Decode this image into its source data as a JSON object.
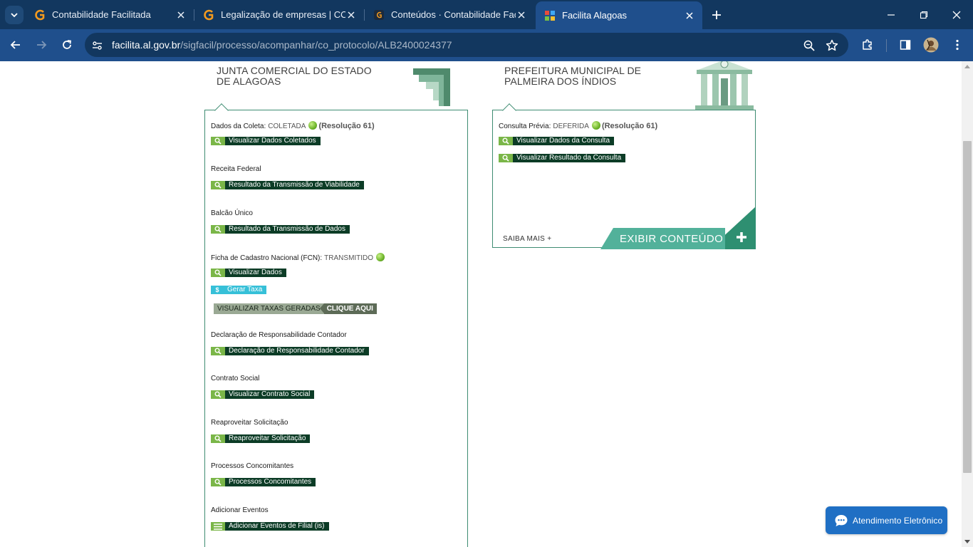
{
  "browser": {
    "tabs": [
      {
        "title": "Contabilidade Facilitada",
        "active": false
      },
      {
        "title": "Legalização de empresas | CON",
        "active": false
      },
      {
        "title": "Conteúdos · Contabilidade Facil",
        "active": false
      },
      {
        "title": "Facilita Alagoas",
        "active": true
      }
    ],
    "url_host": "facilita.al.gov.br",
    "url_path": "/sigfacil/processo/acompanhar/co_protocolo/ALB2400024377"
  },
  "junta": {
    "title_line1": "JUNTA COMERCIAL DO ESTADO",
    "title_line2": "DE ALAGOAS",
    "coleta_label": "Dados da Coleta:",
    "coleta_status": "COLETADA",
    "coleta_res": "(Resolução 61)",
    "btn_visualizar_coletados": "Visualizar Dados Coletados",
    "receita_label": "Receita Federal",
    "btn_viabilidade": "Resultado da Transmissão de Viabilidade",
    "balcao_label": "Balcão Único",
    "btn_transmissao_dados": "Resultado da Transmissão de Dados",
    "fcn_label": "Ficha de Cadastro Nacional (FCN):",
    "fcn_status": "TRANSMITIDO",
    "btn_visualizar_dados": "Visualizar Dados",
    "btn_gerar_taxa": "Gerar Taxa",
    "taxas_label": "VISUALIZAR TAXAS GERADAS",
    "taxas_link": "CLIQUE AQUI",
    "decl_label": "Declaração de Responsabilidade Contador",
    "btn_decl": "Declaração de Responsabilidade Contador",
    "contrato_label": "Contrato Social",
    "btn_contrato": "Visualizar Contrato Social",
    "reaproveitar_label": "Reaproveitar Solicitação",
    "btn_reaproveitar": "Reaproveitar Solicitação",
    "concomitantes_label": "Processos Concomitantes",
    "btn_concomitantes": "Processos Concomitantes",
    "eventos_label": "Adicionar Eventos",
    "btn_eventos": "Adicionar Eventos de Filial (is)"
  },
  "prefeitura": {
    "title_line1": "PREFEITURA MUNICIPAL DE",
    "title_line2": "PALMEIRA DOS ÍNDIOS",
    "consulta_label": "Consulta Prévia:",
    "consulta_status": "DEFERIDA",
    "consulta_res": "(Resolução 61)",
    "btn_dados_consulta": "Visualizar Dados da Consulta",
    "btn_resultado_consulta": "Visualizar Resultado da Consulta",
    "saiba_mais": "SAIBA MAIS +",
    "exibir_conteudo": "EXIBIR CONTEÚDO"
  },
  "chat": {
    "label": "Atendimento Eletrônico"
  },
  "colors": {
    "chrome_dark": "#12375f",
    "chrome": "#1f4f8c",
    "green_dark": "#0c3c26",
    "green_light": "#7ab648",
    "teal": "#52b19a",
    "chat_blue": "#1f6fc4"
  }
}
